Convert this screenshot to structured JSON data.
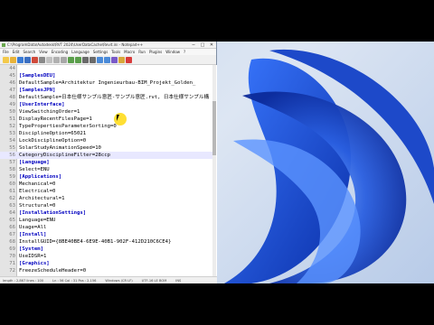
{
  "window": {
    "title": "C:\\ProgramData\\Autodesk\\RVT 2024\\UserDataCache\\Revit.ini - Notepad++",
    "menu": [
      "File",
      "Edit",
      "Search",
      "View",
      "Encoding",
      "Language",
      "Settings",
      "Tools",
      "Macro",
      "Run",
      "Plugins",
      "Window",
      "?"
    ],
    "tab": "Revit.ini",
    "controls": {
      "minimize": "─",
      "maximize": "□",
      "close": "✕"
    }
  },
  "editor": {
    "lines": [
      {
        "n": "44",
        "text": "",
        "kind": "plain"
      },
      {
        "n": "45",
        "text": "[SamplesDEU]",
        "kind": "section"
      },
      {
        "n": "46",
        "text": "DefaultSample=Architektur Ingenieurbau-BIM_Projekt_Golden_",
        "kind": "plain"
      },
      {
        "n": "47",
        "text": "[SamplesJPN]",
        "kind": "section"
      },
      {
        "n": "48",
        "text": "DefaultSample=日本仕様サンプル意匠-サンプル意匠.rvt, 日本仕様サンプル構",
        "kind": "plain"
      },
      {
        "n": "49",
        "text": "[UserInterface]",
        "kind": "section"
      },
      {
        "n": "50",
        "text": "ViewSwitchingOrder=1",
        "kind": "plain"
      },
      {
        "n": "51",
        "text": "DisplayRecentFilesPage=1",
        "kind": "plain"
      },
      {
        "n": "52",
        "text": "TypePropertiesParameterSorting=0",
        "kind": "plain"
      },
      {
        "n": "53",
        "text": "DisciplineOption=65021",
        "kind": "plain"
      },
      {
        "n": "54",
        "text": "LockDisciplineOption=0",
        "kind": "plain"
      },
      {
        "n": "55",
        "text": "SolarStudyAnimationSpeed=10",
        "kind": "plain"
      },
      {
        "n": "56",
        "text": "CategoryDisciplineFilter=28ccp",
        "kind": "highlight"
      },
      {
        "n": "57",
        "text": "[Language]",
        "kind": "section"
      },
      {
        "n": "58",
        "text": "Select=ENU",
        "kind": "plain"
      },
      {
        "n": "59",
        "text": "[Applications]",
        "kind": "section"
      },
      {
        "n": "60",
        "text": "Mechanical=0",
        "kind": "plain"
      },
      {
        "n": "61",
        "text": "Electrical=0",
        "kind": "plain"
      },
      {
        "n": "62",
        "text": "Architectural=1",
        "kind": "plain"
      },
      {
        "n": "63",
        "text": "Structural=0",
        "kind": "plain"
      },
      {
        "n": "64",
        "text": "[InstallationSettings]",
        "kind": "section"
      },
      {
        "n": "65",
        "text": "Language=ENU",
        "kind": "plain"
      },
      {
        "n": "66",
        "text": "Usage=All",
        "kind": "plain"
      },
      {
        "n": "67",
        "text": "[Install]",
        "kind": "section"
      },
      {
        "n": "68",
        "text": "InstallGUID={8BE40BE4-6E9E-40B1-902F-412D210C6CE4}",
        "kind": "plain"
      },
      {
        "n": "69",
        "text": "[System]",
        "kind": "section"
      },
      {
        "n": "70",
        "text": "UseIDSR=1",
        "kind": "plain"
      },
      {
        "n": "71",
        "text": "[Graphics]",
        "kind": "section"
      },
      {
        "n": "72",
        "text": "FreezeScheduleHeader=0",
        "kind": "plain"
      }
    ]
  },
  "status": {
    "length": "length : 2,867   lines : 100",
    "position": "Ln : 56   Col : 31   Pos : 2,156",
    "eol": "Windows (CR LF)",
    "encoding": "UTF-16 LE BOM",
    "mode": "INS"
  },
  "colors": {
    "section": "#0000c0",
    "highlight": "#e8e8ff",
    "wallpaper_blue": "#1b4fd6"
  }
}
